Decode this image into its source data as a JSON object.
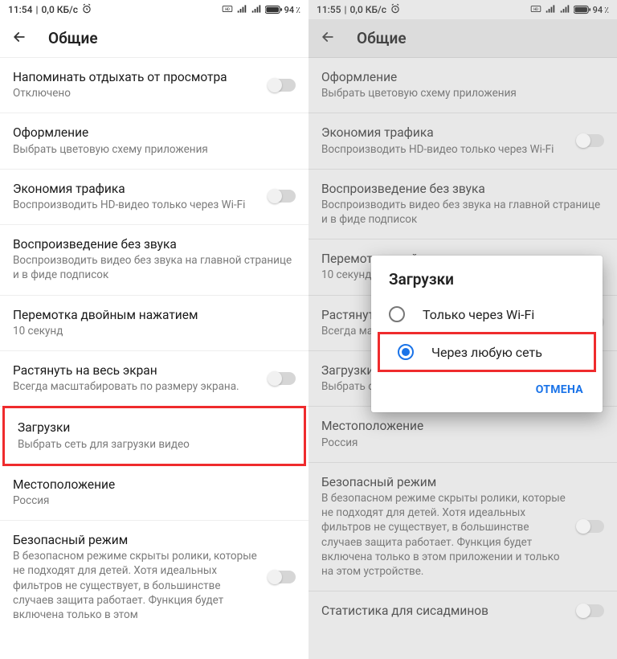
{
  "left": {
    "status": {
      "time": "11:54",
      "net": "0,0 КБ/с",
      "battery": "94"
    },
    "appbar_title": "Общие",
    "items": [
      {
        "title": "Напоминать отдыхать от просмотра",
        "sub": "Отключено",
        "toggle": true
      },
      {
        "title": "Оформление",
        "sub": "Выбрать цветовую схему приложения"
      },
      {
        "title": "Экономия трафика",
        "sub": "Воспроизводить HD-видео только через Wi-Fi",
        "toggle": true
      },
      {
        "title": "Воспроизведение без звука",
        "sub": "Воспроизводить видео без звука на главной странице и в фиде подписок"
      },
      {
        "title": "Перемотка двойным нажатием",
        "sub": "10 секунд"
      },
      {
        "title": "Растянуть на весь экран",
        "sub": "Всегда масштабировать по размеру экрана.",
        "toggle": true
      },
      {
        "title": "Загрузки",
        "sub": "Выбрать сеть для загрузки видео",
        "highlight": true
      },
      {
        "title": "Местоположение",
        "sub": "Россия"
      },
      {
        "title": "Безопасный режим",
        "sub": "В безопасном режиме скрыты ролики, которые не подходят для детей. Хотя идеальных фильтров не существует, в большинстве случаев защита работает. Функция будет включена только в этом",
        "toggle": true
      }
    ]
  },
  "right": {
    "status": {
      "time": "11:55",
      "net": "0,0 КБ/с",
      "battery": "94"
    },
    "appbar_title": "Общие",
    "items": [
      {
        "title": "Оформление",
        "sub": "Выбрать цветовую схему приложения"
      },
      {
        "title": "Экономия трафика",
        "sub": "Воспроизводить HD-видео только через Wi-Fi",
        "toggle": true
      },
      {
        "title": "Воспроизведение без звука",
        "sub": "Воспроизводить видео без звука на главной странице и в фиде подписок"
      },
      {
        "title": "Перемотка двойным нажатием",
        "sub": "10 секунд"
      },
      {
        "title": "Растянуть на весь экран",
        "sub": "Всегда масштабировать по размеру экрана.",
        "toggle": true
      },
      {
        "title": "Загрузки",
        "sub": "Выбрать сеть для загрузки видео"
      },
      {
        "title": "Местоположение",
        "sub": "Россия"
      },
      {
        "title": "Безопасный режим",
        "sub": "В безопасном режиме скрыты ролики, которые не подходят для детей. Хотя идеальных фильтров не существует, в большинстве случаев защита работает. Функция будет включена только в этом приложении и только на этом устройстве.",
        "toggle": true
      },
      {
        "title": "Статистика для сисадминов",
        "toggle": true
      }
    ],
    "dialog": {
      "title": "Загрузки",
      "option_wifi": "Только через Wi-Fi",
      "option_any": "Через любую сеть",
      "cancel": "ОТМЕНА"
    }
  }
}
